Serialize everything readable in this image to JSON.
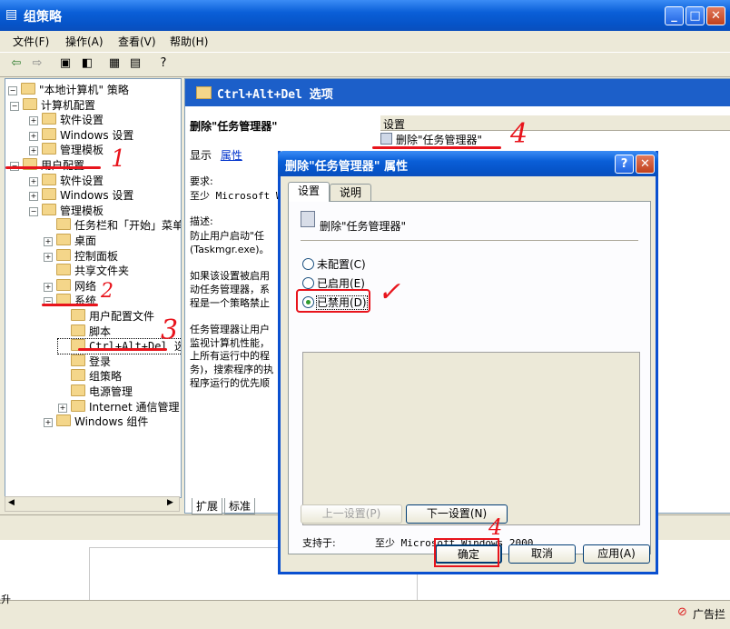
{
  "window": {
    "title": "组策略"
  },
  "menu": [
    "文件(F)",
    "操作(A)",
    "查看(V)",
    "帮助(H)"
  ],
  "tree": [
    {
      "label": "\"本地计算机\" 策略",
      "indent": 0
    },
    {
      "label": "计算机配置",
      "indent": 1
    },
    {
      "label": "软件设置",
      "indent": 2
    },
    {
      "label": "Windows 设置",
      "indent": 2
    },
    {
      "label": "管理模板",
      "indent": 2
    },
    {
      "label": "用户配置",
      "indent": 1
    },
    {
      "label": "软件设置",
      "indent": 2
    },
    {
      "label": "Windows 设置",
      "indent": 2
    },
    {
      "label": "管理模板",
      "indent": 2
    },
    {
      "label": "任务栏和「开始」菜单",
      "indent": 3
    },
    {
      "label": "桌面",
      "indent": 3
    },
    {
      "label": "控制面板",
      "indent": 3
    },
    {
      "label": "共享文件夹",
      "indent": 3
    },
    {
      "label": "网络",
      "indent": 3
    },
    {
      "label": "系统",
      "indent": 3
    },
    {
      "label": "用户配置文件",
      "indent": 4
    },
    {
      "label": "脚本",
      "indent": 4
    },
    {
      "label": "Ctrl+Alt+Del 选项",
      "indent": 4
    },
    {
      "label": "登录",
      "indent": 4
    },
    {
      "label": "组策略",
      "indent": 4
    },
    {
      "label": "电源管理",
      "indent": 4
    },
    {
      "label": "Internet 通信管理",
      "indent": 4
    },
    {
      "label": "Windows 组件",
      "indent": 3
    }
  ],
  "right": {
    "header": "Ctrl+Alt+Del 选项",
    "policy_title": "删除\"任务管理器\"",
    "show": "显示",
    "properties_link": "属性",
    "requirement_label": "要求:",
    "requirement": "至少 Microsoft W",
    "desc_label": "描述:",
    "desc_lines": [
      "防止用户启动\"任",
      "(Taskmgr.exe)。",
      "",
      "如果该设置被启用",
      "动任务管理器，系",
      "程是一个策略禁止",
      "",
      "任务管理器让用户",
      "监视计算机性能，",
      "上所有运行中的程",
      "务)，搜索程序的执",
      "程序运行的优先顺"
    ],
    "column_header": "设置",
    "list_item": "删除\"任务管理器\"",
    "tabs": [
      "扩展",
      "标准"
    ]
  },
  "dialog": {
    "title": "删除\"任务管理器\" 属性",
    "tabs": [
      "设置",
      "说明"
    ],
    "policy_name": "删除\"任务管理器\"",
    "options": [
      "未配置(C)",
      "已启用(E)",
      "已禁用(D)"
    ],
    "selected": "已禁用(D)",
    "supported_label": "支持于:",
    "supported_value": "至少 Microsoft Windows 2000",
    "prev_button": "上一设置(P)",
    "next_button": "下一设置(N)",
    "ok": "确定",
    "cancel": "取消",
    "apply": "应用(A)"
  },
  "desktop": {
    "left_text": "提升",
    "right_text": "广告拦"
  },
  "annotations": [
    "1",
    "2",
    "3",
    "4",
    "4"
  ]
}
